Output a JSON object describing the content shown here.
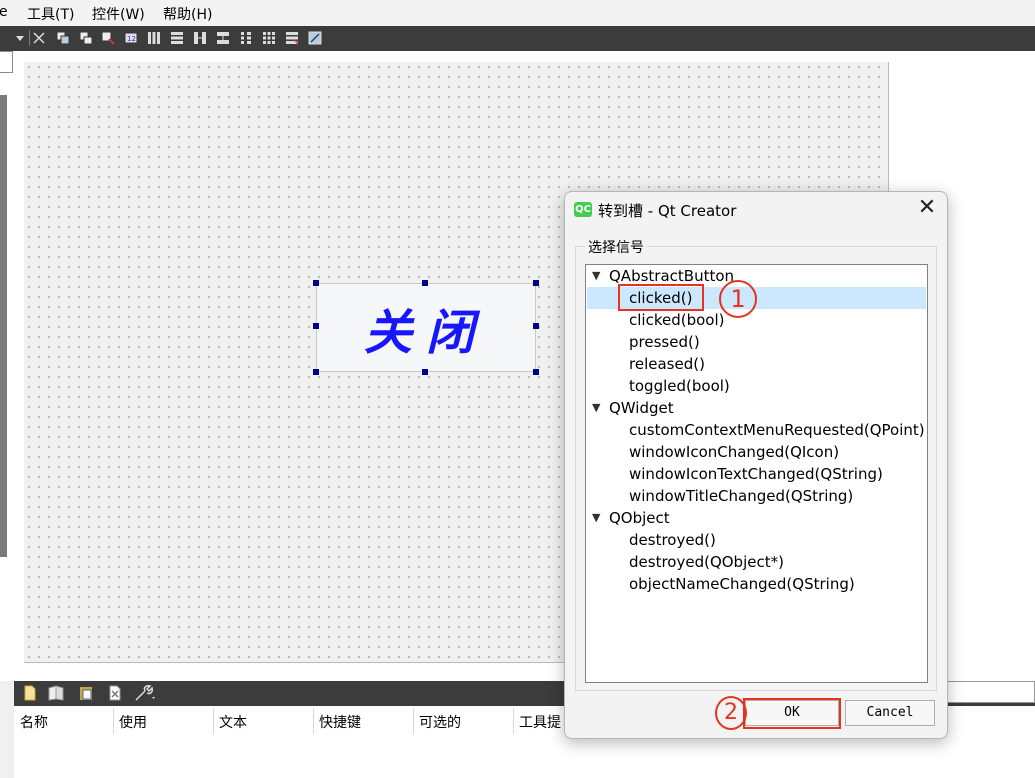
{
  "menubar": {
    "items": [
      "e",
      "工具(T)",
      "控件(W)",
      "帮助(H)"
    ]
  },
  "form": {
    "button_text": "关闭"
  },
  "bottom_panel": {
    "columns": [
      "名称",
      "使用",
      "文本",
      "快捷键",
      "可选的",
      "工具提"
    ]
  },
  "dialog": {
    "logo_text": "QC",
    "title": "转到槽 - Qt Creator",
    "close_glyph": "✕",
    "group_title": "选择信号",
    "tree": [
      {
        "class": "QAbstractButton",
        "signals": [
          "clicked()",
          "clicked(bool)",
          "pressed()",
          "released()",
          "toggled(bool)"
        ]
      },
      {
        "class": "QWidget",
        "signals": [
          "customContextMenuRequested(QPoint)",
          "windowIconChanged(QIcon)",
          "windowIconTextChanged(QString)",
          "windowTitleChanged(QString)"
        ]
      },
      {
        "class": "QObject",
        "signals": [
          "destroyed()",
          "destroyed(QObject*)",
          "objectNameChanged(QString)"
        ]
      }
    ],
    "selected_signal": "clicked()",
    "ok_label": "OK",
    "cancel_label": "Cancel"
  },
  "annotations": {
    "step1": "1",
    "step2": "2",
    "color": "#e8321e"
  },
  "colors": {
    "toolbar": "#3c3c3c",
    "selection": "#cce8ff",
    "button_text": "#1616ff",
    "qt_green": "#41cd52"
  }
}
